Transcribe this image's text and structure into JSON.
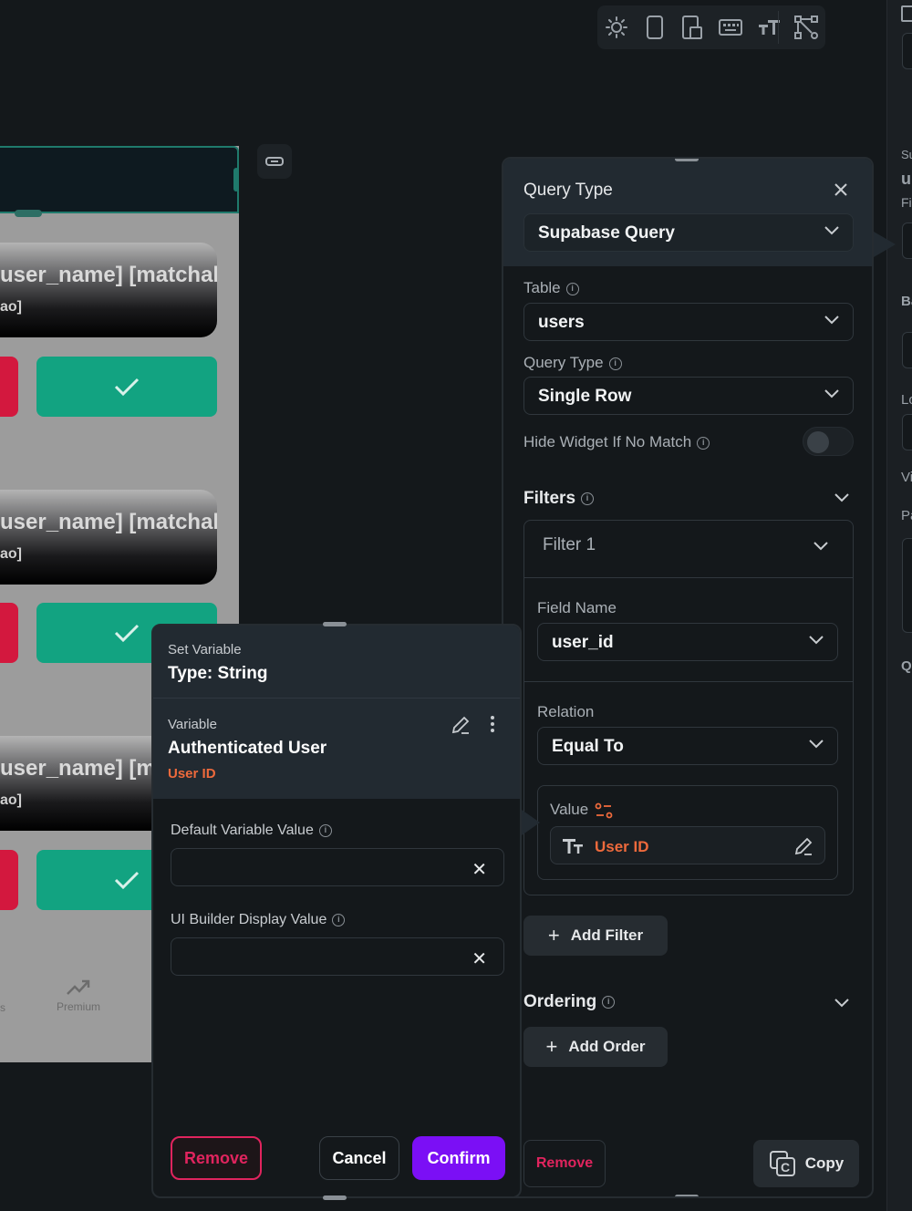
{
  "phone": {
    "card_title": "user_name] [matchal",
    "card_title_short": "user_name] [m",
    "card_sub": "ao]",
    "nav_left": "s",
    "nav_premium": "Premium"
  },
  "edge_panel": {
    "letters": [
      "Su",
      "u",
      "Fi",
      "Ba",
      "Lo",
      "Vi",
      "Pa",
      "Q"
    ]
  },
  "query_panel": {
    "header_label": "Query Type",
    "header_value": "Supabase Query",
    "table_label": "Table",
    "table_value": "users",
    "query_type_label": "Query Type",
    "query_type_value": "Single Row",
    "hide_widget_label": "Hide Widget If No Match",
    "hide_widget_on": false,
    "filters_label": "Filters",
    "filter1_label": "Filter 1",
    "field_name_label": "Field Name",
    "field_name_value": "user_id",
    "relation_label": "Relation",
    "relation_value": "Equal To",
    "value_label": "Value",
    "value_value": "User ID",
    "add_filter": "Add Filter",
    "ordering_label": "Ordering",
    "add_order": "Add Order",
    "remove": "Remove",
    "copy": "Copy"
  },
  "set_variable": {
    "title": "Set Variable",
    "type": "Type: String",
    "variable_label": "Variable",
    "variable_value": "Authenticated User",
    "variable_sub": "User ID",
    "default_label": "Default Variable Value",
    "default_value": "",
    "display_label": "UI Builder Display Value",
    "display_value": "",
    "remove": "Remove",
    "cancel": "Cancel",
    "confirm": "Confirm"
  },
  "colors": {
    "accent_purple": "#7b0ff5",
    "danger": "#e0245e",
    "orange_label": "#ee6a3c",
    "green": "#12a381"
  }
}
